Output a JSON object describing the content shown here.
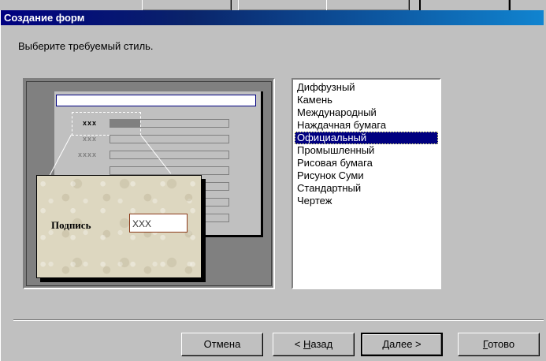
{
  "window": {
    "title": "Создание форм"
  },
  "prompt": "Выберите требуемый стиль.",
  "preview": {
    "row_labels": [
      "xxx",
      "xxx",
      "xxxx"
    ],
    "zoom_label": "Подпись",
    "zoom_value": "XXX"
  },
  "styles": {
    "items": [
      "Диффузный",
      "Камень",
      "Международный",
      "Наждачная бумага",
      "Официальный",
      "Промышленный",
      "Рисовая бумага",
      "Рисунок Суми",
      "Стандартный",
      "Чертеж"
    ],
    "selected": "Официальный"
  },
  "buttons": {
    "cancel": "Отмена",
    "back_prefix": "< ",
    "back_accel": "Н",
    "back_rest": "азад",
    "next_accel": "Д",
    "next_rest": "алее >",
    "finish_accel": "Г",
    "finish_rest": "отово"
  },
  "colors": {
    "titlebar_start": "#000080",
    "titlebar_end": "#1084d0",
    "selection": "#000080"
  }
}
